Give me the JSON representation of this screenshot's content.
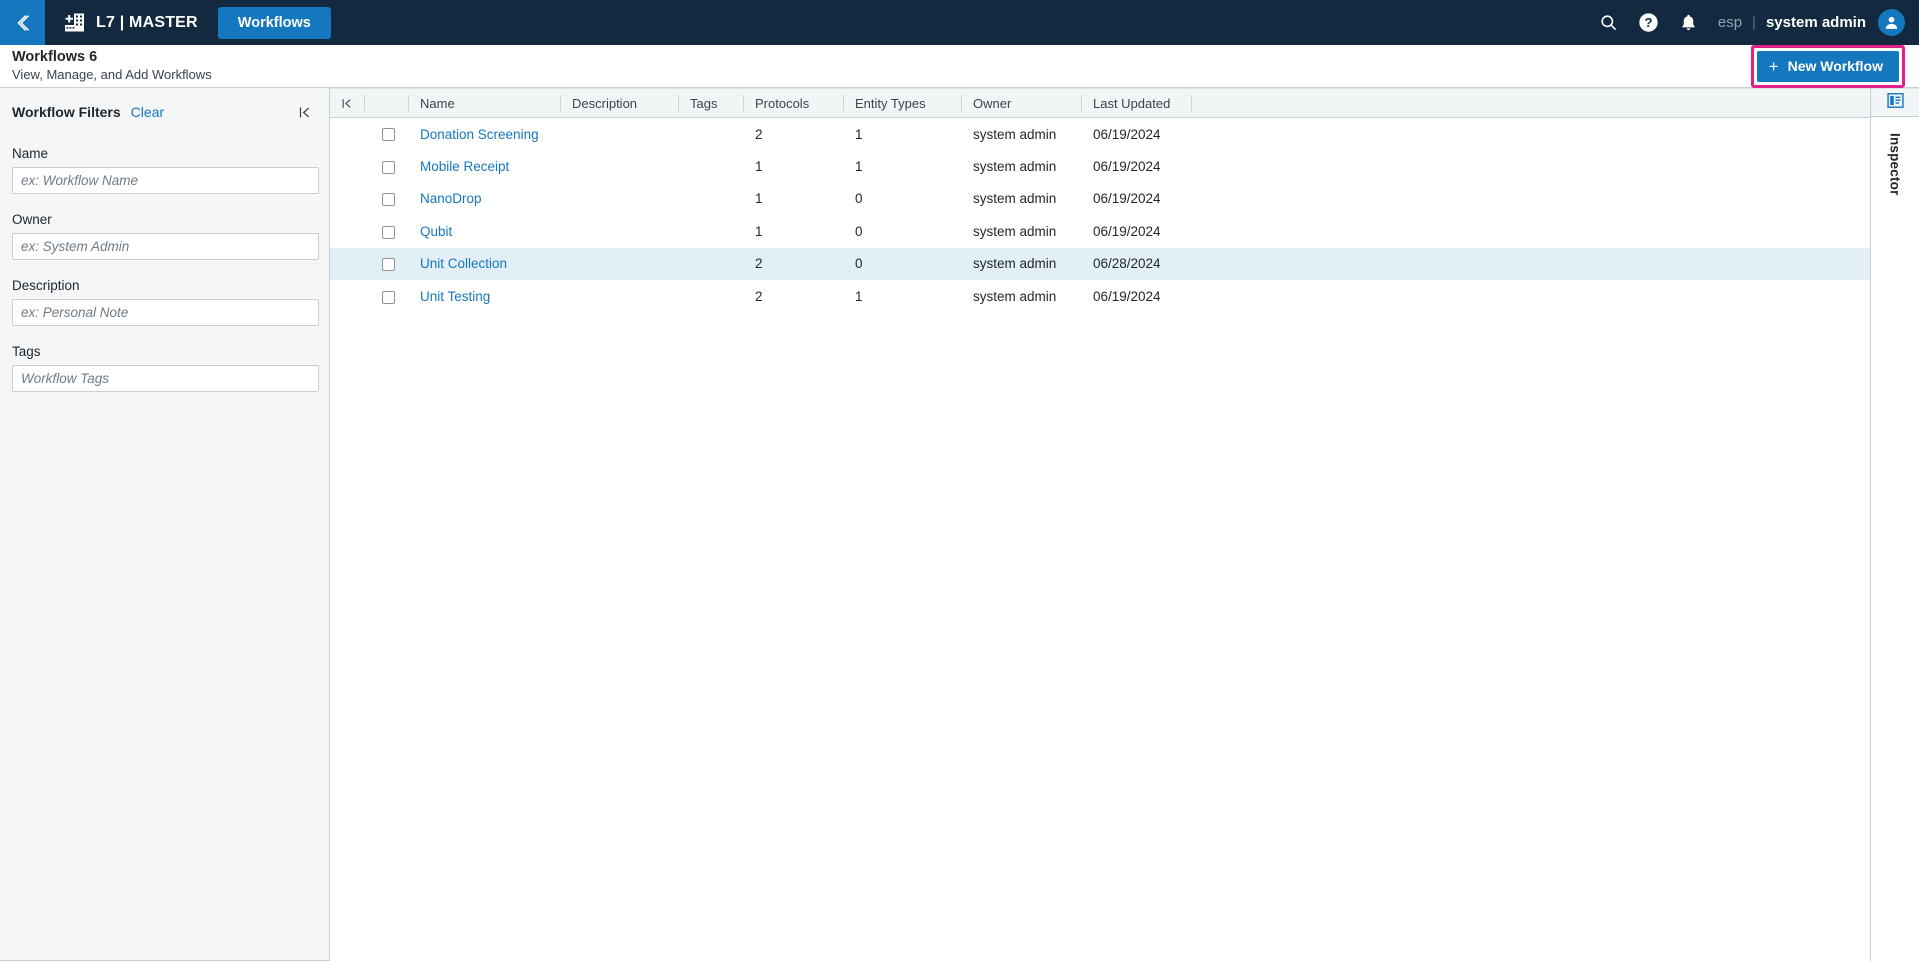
{
  "topbar": {
    "back_icon": "chevron-left-icon",
    "logo_icon": "building-add-icon",
    "brand": "L7 | MASTER",
    "active_tab": "Workflows",
    "search_icon": "search-icon",
    "help_icon": "help-circle-icon",
    "notifications_icon": "bell-icon",
    "locale": "esp",
    "separator": "|",
    "user": "system admin",
    "avatar_icon": "user-avatar-icon",
    "bg_color": "#12293f",
    "accent_color": "#1577bd"
  },
  "page_header": {
    "title": "Workflows 6",
    "subtitle": "View, Manage, and Add Workflows",
    "new_button_label": "New Workflow",
    "new_button_plus": "+",
    "highlight_color": "#e0218a"
  },
  "sidebar": {
    "title": "Workflow Filters",
    "clear_label": "Clear",
    "collapse_icon": "collapse-panel-left-icon",
    "fields": [
      {
        "label": "Name",
        "placeholder": "ex: Workflow Name",
        "value": ""
      },
      {
        "label": "Owner",
        "placeholder": "ex: System Admin",
        "value": ""
      },
      {
        "label": "Description",
        "placeholder": "ex: Personal Note",
        "value": ""
      },
      {
        "label": "Tags",
        "placeholder": "Workflow Tags",
        "value": ""
      }
    ]
  },
  "table": {
    "handle_icon": "collapse-columns-icon",
    "columns": [
      "Name",
      "Description",
      "Tags",
      "Protocols",
      "Entity Types",
      "Owner",
      "Last Updated"
    ],
    "rows": [
      {
        "name": "Donation Screening",
        "description": "",
        "tags": "",
        "protocols": "2",
        "entity_types": "1",
        "owner": "system admin",
        "last_updated": "06/19/2024",
        "selected": false,
        "checked": false
      },
      {
        "name": "Mobile Receipt",
        "description": "",
        "tags": "",
        "protocols": "1",
        "entity_types": "1",
        "owner": "system admin",
        "last_updated": "06/19/2024",
        "selected": false,
        "checked": false
      },
      {
        "name": "NanoDrop",
        "description": "",
        "tags": "",
        "protocols": "1",
        "entity_types": "0",
        "owner": "system admin",
        "last_updated": "06/19/2024",
        "selected": false,
        "checked": false
      },
      {
        "name": "Qubit",
        "description": "",
        "tags": "",
        "protocols": "1",
        "entity_types": "0",
        "owner": "system admin",
        "last_updated": "06/19/2024",
        "selected": false,
        "checked": false
      },
      {
        "name": "Unit Collection",
        "description": "",
        "tags": "",
        "protocols": "2",
        "entity_types": "0",
        "owner": "system admin",
        "last_updated": "06/28/2024",
        "selected": true,
        "checked": false
      },
      {
        "name": "Unit Testing",
        "description": "",
        "tags": "",
        "protocols": "2",
        "entity_types": "1",
        "owner": "system admin",
        "last_updated": "06/19/2024",
        "selected": false,
        "checked": false
      }
    ]
  },
  "inspector": {
    "label": "Inspector",
    "icon": "inspector-panel-icon"
  }
}
